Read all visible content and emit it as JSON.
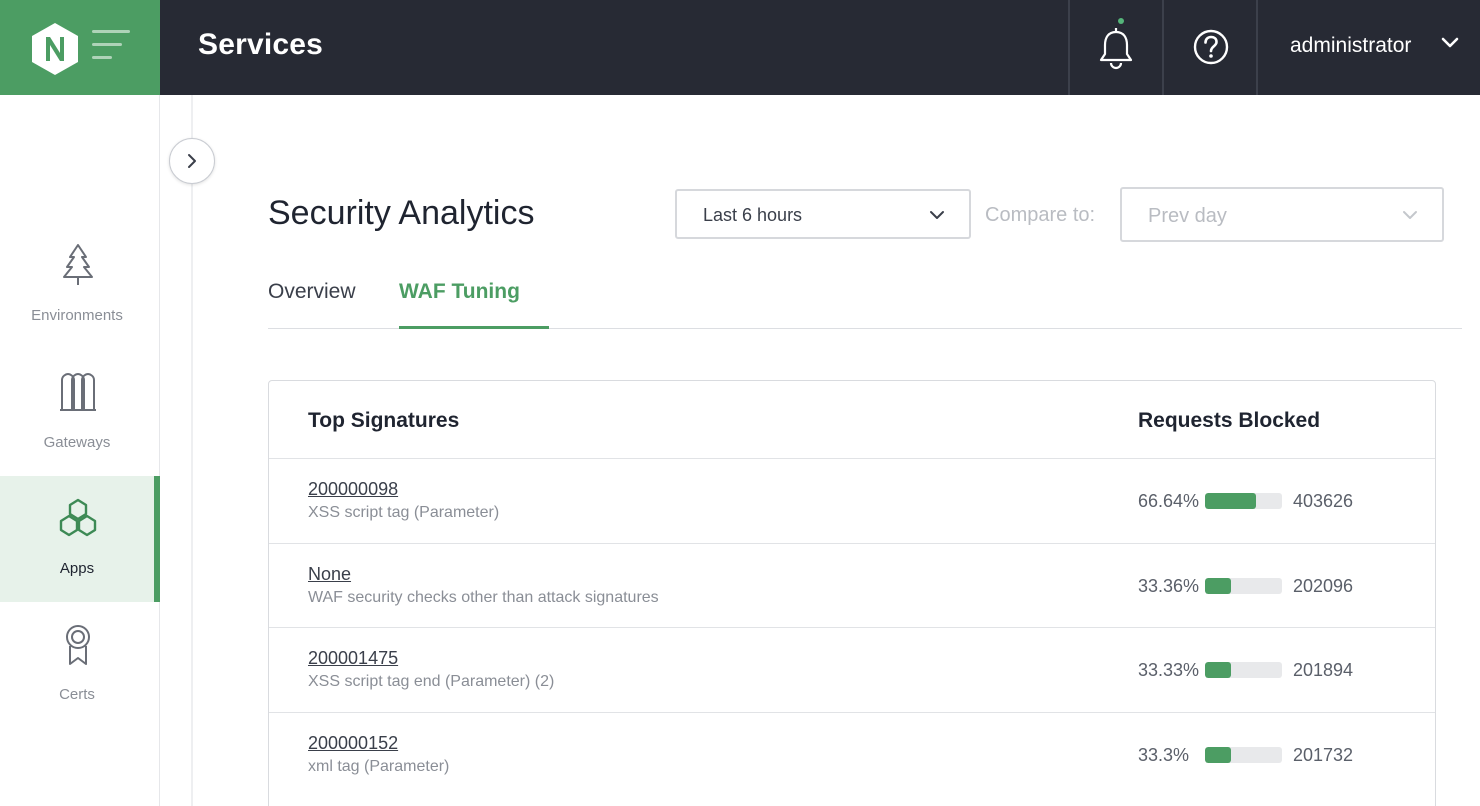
{
  "header": {
    "title": "Services",
    "user": "administrator",
    "notification_icon": "bell-icon",
    "help_icon": "help-icon",
    "brand_color": "#4c9d63"
  },
  "sidebar": {
    "items": [
      {
        "label": "Environments",
        "icon": "tree-icon",
        "active": false
      },
      {
        "label": "Gateways",
        "icon": "gateways-icon",
        "active": false
      },
      {
        "label": "Apps",
        "icon": "hexagons-icon",
        "active": true
      },
      {
        "label": "Certs",
        "icon": "ribbon-icon",
        "active": false
      }
    ]
  },
  "main": {
    "title": "Security Analytics",
    "time_range": "Last 6 hours",
    "compare_label": "Compare to:",
    "compare_value": "Prev day",
    "tabs": [
      {
        "label": "Overview",
        "active": false
      },
      {
        "label": "WAF Tuning",
        "active": true
      }
    ],
    "table": {
      "col_signatures": "Top Signatures",
      "col_blocked": "Requests Blocked",
      "rows": [
        {
          "id": "200000098",
          "desc": "XSS script tag (Parameter)",
          "pct": "66.64%",
          "fraction": 0.6664,
          "count": "403626"
        },
        {
          "id": "None",
          "desc": "WAF security checks other than attack signatures",
          "pct": "33.36%",
          "fraction": 0.3336,
          "count": "202096"
        },
        {
          "id": "200001475",
          "desc": "XSS script tag end (Parameter) (2)",
          "pct": "33.33%",
          "fraction": 0.3333,
          "count": "201894"
        },
        {
          "id": "200000152",
          "desc": "xml tag (Parameter)",
          "pct": "33.3%",
          "fraction": 0.333,
          "count": "201732"
        }
      ]
    }
  }
}
